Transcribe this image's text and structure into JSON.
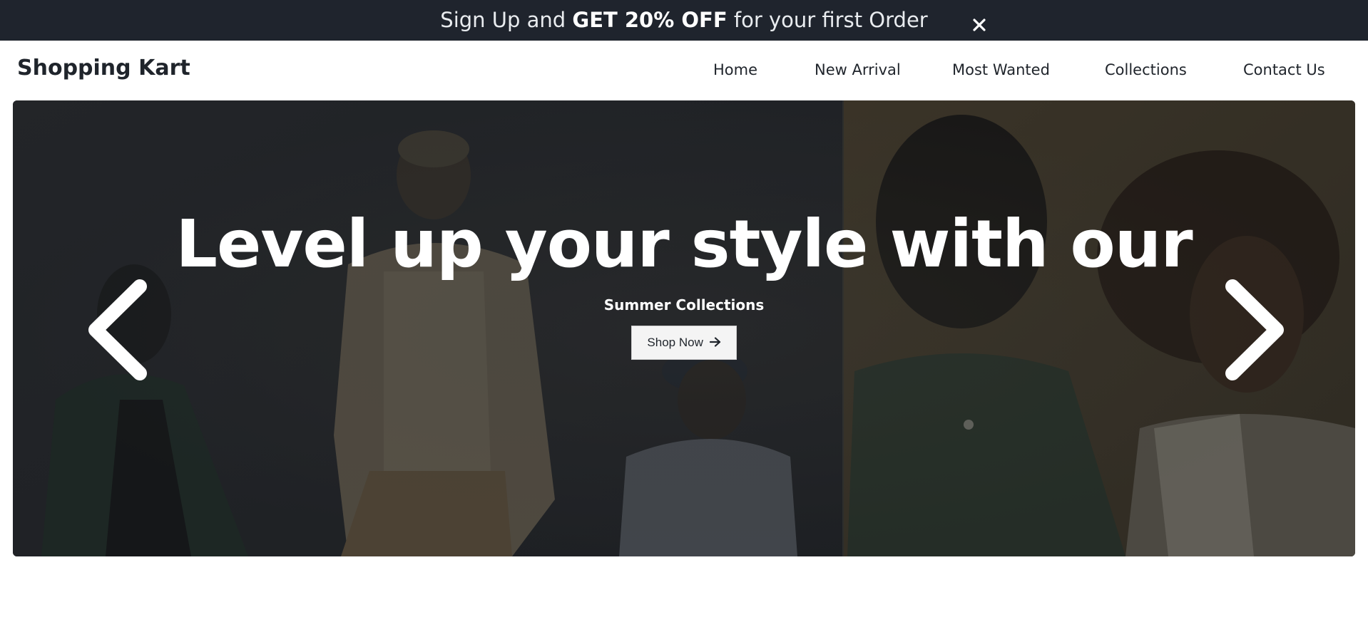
{
  "announcement": {
    "prefix": "Sign Up and ",
    "highlight": "GET 20% OFF",
    "suffix": " for your first Order",
    "close_icon": "close-icon"
  },
  "header": {
    "logo": "Shopping Kart",
    "nav": [
      "Home",
      "New Arrival",
      "Most Wanted",
      "Collections",
      "Contact Us"
    ]
  },
  "hero": {
    "title": "Level up your style with our",
    "subtitle": "Summer Collections",
    "cta_label": "Shop Now",
    "cta_icon": "arrow-right-icon",
    "prev_icon": "chevron-left-icon",
    "next_icon": "chevron-right-icon"
  },
  "colors": {
    "announce_bg": "#1f242d",
    "text_dark": "#1f242b",
    "hero_left": "#2a2c31",
    "hero_right": "#4a3e2c"
  }
}
